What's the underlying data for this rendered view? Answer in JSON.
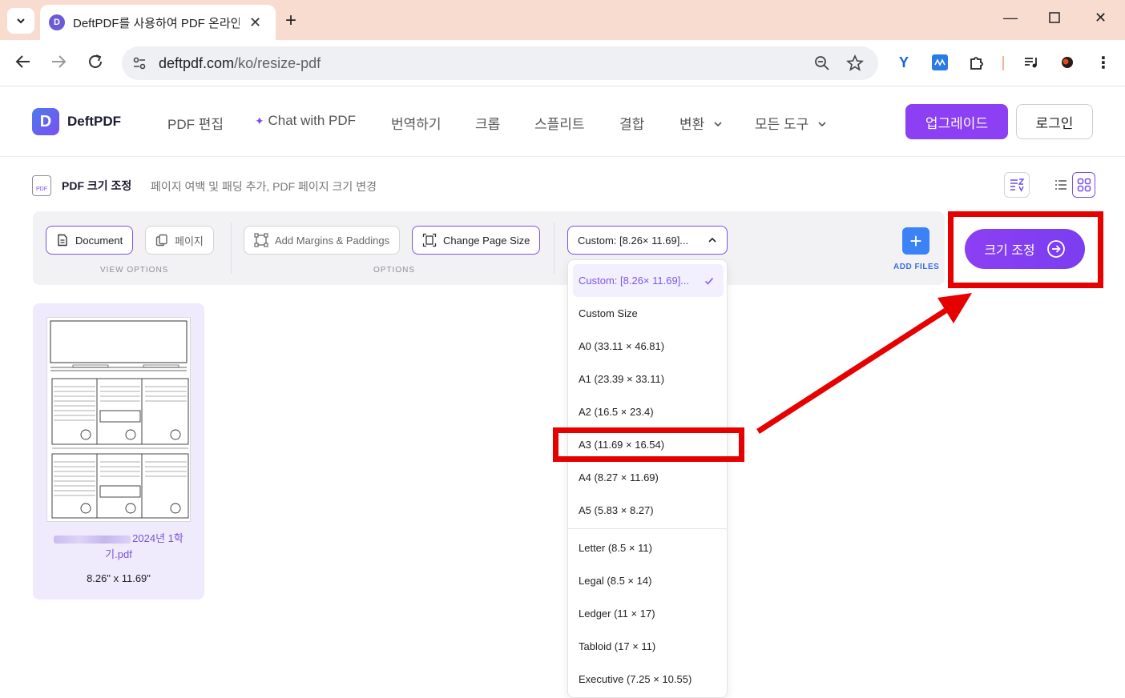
{
  "browser": {
    "tab_title": "DeftPDF를 사용하여 PDF 온라인",
    "tab_favicon": "D",
    "url_host": "deftpdf.com",
    "url_path": "/ko/resize-pdf"
  },
  "header": {
    "logo_mark": "D",
    "logo_text": "DeftPDF",
    "nav": {
      "edit": "PDF 편집",
      "chat": "Chat with PDF",
      "translate": "번역하기",
      "crop": "크롭",
      "split": "스플리트",
      "merge": "결합",
      "convert": "변환",
      "all_tools": "모든 도구"
    },
    "upgrade": "업그레이드",
    "login": "로그인"
  },
  "page": {
    "icon_text": "PDF",
    "title": "PDF 크기 조정",
    "subtitle": "페이지 여백 및 패딩 추가, PDF 페이지 크기 변경"
  },
  "toolbar": {
    "document": "Document",
    "page": "페이지",
    "view_options": "VIEW OPTIONS",
    "add_margins": "Add Margins & Paddings",
    "change_page_size": "Change Page Size",
    "options": "OPTIONS",
    "select_value": "Custom: [8.26× 11.69]...",
    "add_files": "ADD FILES"
  },
  "resize_button": "크기 조정",
  "dropdown": {
    "options": [
      "Custom: [8.26× 11.69]...",
      "Custom Size",
      "A0 (33.11 × 46.81)",
      "A1 (23.39 × 33.11)",
      "A2 (16.5 × 23.4)",
      "A3 (11.69 × 16.54)",
      "A4 (8.27 × 11.69)",
      "A5 (5.83 × 8.27)",
      "Letter (8.5 × 11)",
      "Legal (8.5 × 14)",
      "Ledger (11 × 17)",
      "Tabloid (17 × 11)",
      "Executive (7.25 × 10.55)"
    ],
    "selected": "Custom: [8.26× 11.69]...",
    "highlighted": "A3 (11.69 × 16.54)"
  },
  "file": {
    "name_visible": "2024년 1학",
    "name_line2": "기.pdf",
    "size": "8.26\" x 11.69\""
  },
  "colors": {
    "accent": "#8c3ff3",
    "annotation": "#e60000",
    "add_files": "#3b82f6"
  }
}
